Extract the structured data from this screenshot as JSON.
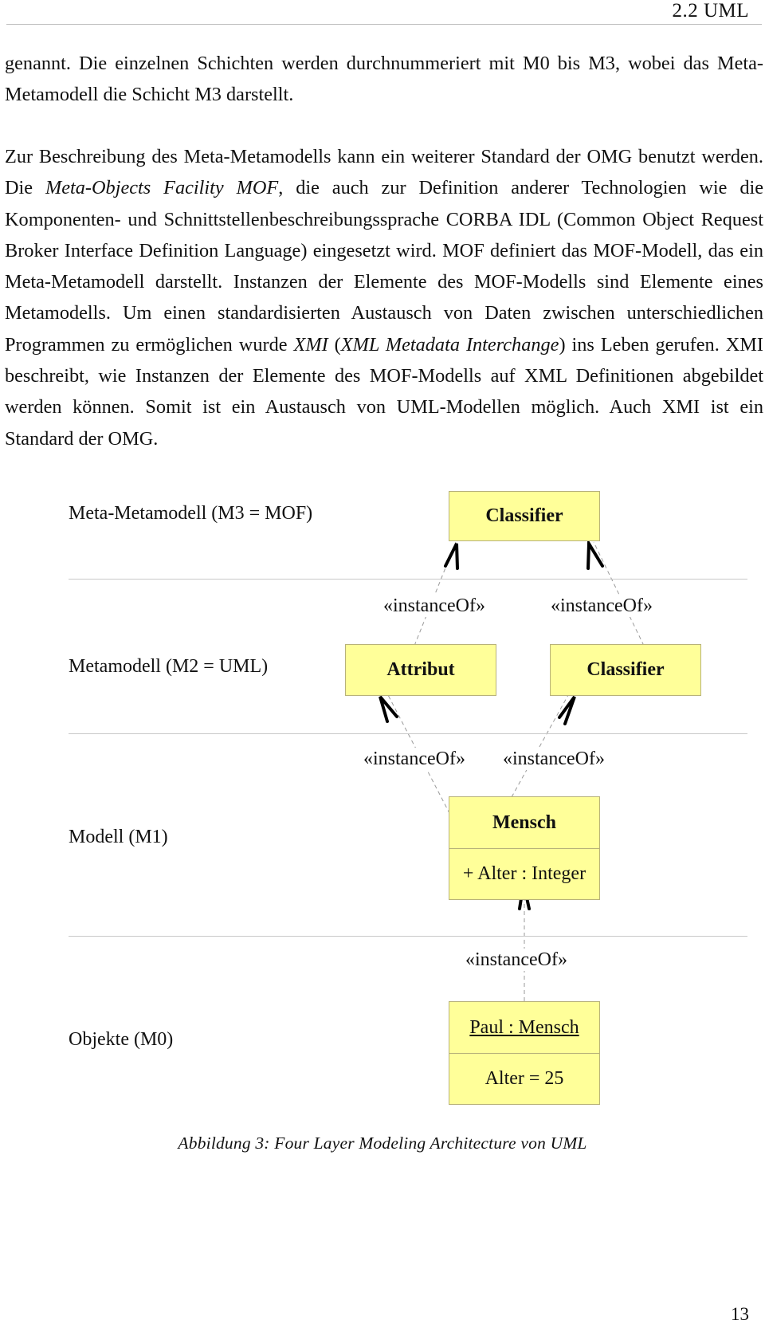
{
  "header": {
    "running_head": "2.2  UML"
  },
  "body": {
    "paragraph1": "genannt. Die einzelnen Schichten werden durchnummeriert mit M0 bis M3, wobei das Meta-Metamodell die Schicht M3 darstellt.",
    "paragraph2": {
      "part1": "Zur Beschreibung des Meta-Metamodells kann ein weiterer Standard der OMG benutzt werden. Die ",
      "italic1": "Meta-Objects Facility MOF",
      "part2": ", die auch zur Definition anderer Technologien wie die Komponenten- und Schnittstellenbeschreibungssprache CORBA IDL (Common Object Request Broker Interface Definition Language) eingesetzt wird. MOF definiert das MOF-Modell, das ein Meta-Metamodell darstellt. Instanzen der Elemente des MOF-Modells sind Elemente eines Metamodells. Um einen standardisierten Austausch von Daten zwischen unterschiedlichen Programmen zu ermöglichen wurde  ",
      "italic2": "XMI",
      "part3": " (",
      "italic3": "XML Metadata Interchange",
      "part4": ") ins Leben gerufen. XMI beschreibt, wie Instanzen der Elemente des MOF-Modells auf XML Definitionen abgebildet werden können. Somit ist ein Austausch von UML-Modellen möglich. Auch XMI ist ein Standard der OMG."
    }
  },
  "diagram": {
    "colors": {
      "box_fill": "#ffff99",
      "box_border": "#b8b27a",
      "arrow": "#000000",
      "dashed_line": "#9a9a9a",
      "layer_rule": "#c8c8c8"
    },
    "layers": [
      {
        "label": "Meta-Metamodell (M3 = MOF)"
      },
      {
        "label": "Metamodell (M2 = UML)"
      },
      {
        "label": "Modell (M1)"
      },
      {
        "label": "Objekte (M0)"
      }
    ],
    "m3_classifier": "Classifier",
    "m2_attribut": "Attribut",
    "m2_classifier": "Classifier",
    "m1_class": {
      "name": "Mensch",
      "attribute": "+ Alter : Integer"
    },
    "m0_object": {
      "name": "Paul : Mensch",
      "slot": "Alter = 25"
    },
    "stereotype": "«instanceOf»",
    "relations": [
      {
        "from": "Attribut",
        "to": "Classifier (M3)",
        "label": "«instanceOf»"
      },
      {
        "from": "Classifier (M2)",
        "to": "Classifier (M3)",
        "label": "«instanceOf»"
      },
      {
        "from": "Mensch",
        "to": "Attribut",
        "label": "«instanceOf»"
      },
      {
        "from": "Mensch",
        "to": "Classifier (M2)",
        "label": "«instanceOf»"
      },
      {
        "from": "Paul : Mensch",
        "to": "Mensch",
        "label": "«instanceOf»"
      }
    ]
  },
  "caption": "Abbildung 3:  Four Layer Modeling Architecture von UML",
  "footer": {
    "page_number": "13"
  }
}
